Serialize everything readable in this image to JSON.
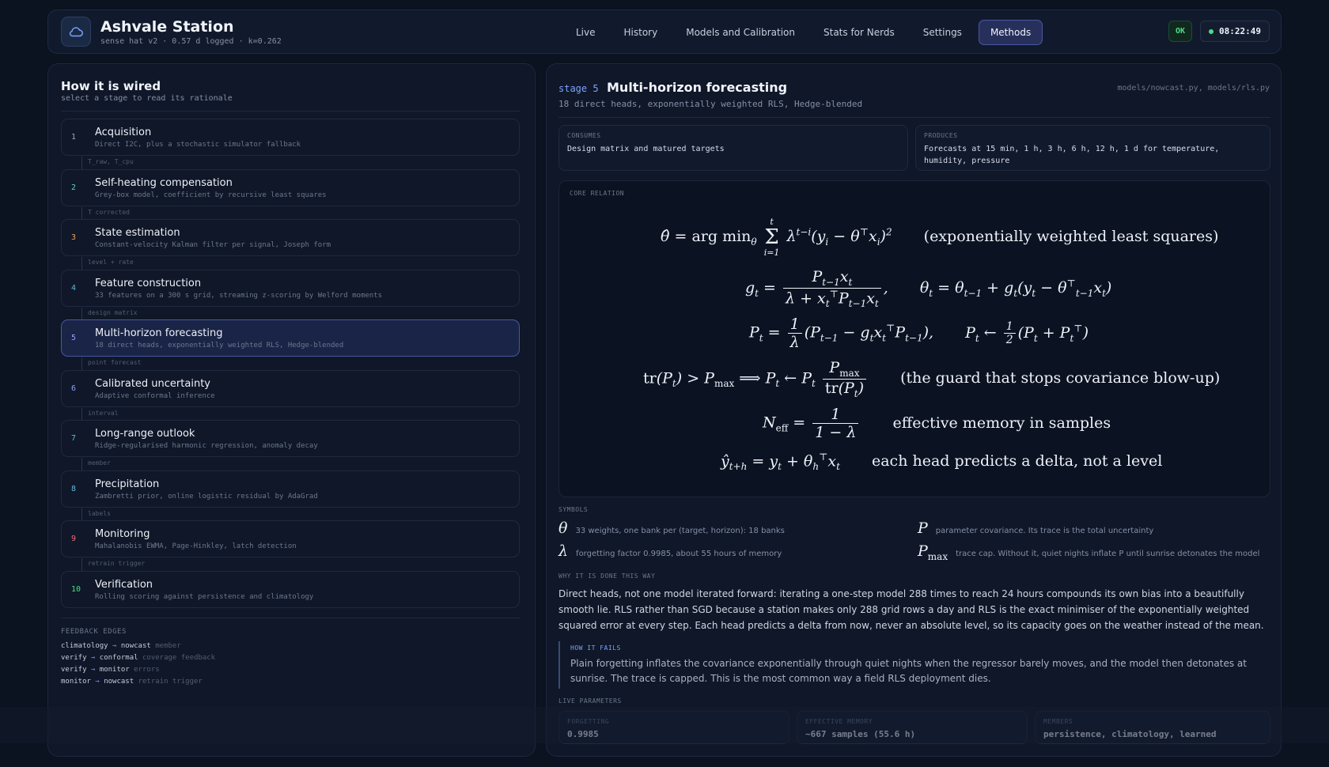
{
  "header": {
    "title": "Ashvale Station",
    "subtitle": "sense hat v2 · 0.57 d logged · k=0.262",
    "nav": [
      "Live",
      "History",
      "Models and Calibration",
      "Stats for Nerds",
      "Settings",
      "Methods"
    ],
    "active_nav": "Methods",
    "status": "OK",
    "clock": "08:22:49"
  },
  "left": {
    "title": "How it is wired",
    "subtitle": "select a stage to read its rationale",
    "stages": [
      {
        "num": "1",
        "name": "Acquisition",
        "desc": "Direct I2C, plus a stochastic simulator fallback",
        "color": "#9aa6bf"
      },
      {
        "num": "2",
        "name": "Self-heating compensation",
        "desc": "Grey-box model, coefficient by recursive least squares",
        "color": "#5fd0c0"
      },
      {
        "num": "3",
        "name": "State estimation",
        "desc": "Constant-velocity Kalman filter per signal, Joseph form",
        "color": "#f0a35a"
      },
      {
        "num": "4",
        "name": "Feature construction",
        "desc": "33 features on a 300 s grid, streaming z-scoring by Welford moments",
        "color": "#5fb8e0"
      },
      {
        "num": "5",
        "name": "Multi-horizon forecasting",
        "desc": "18 direct heads, exponentially weighted RLS, Hedge-blended",
        "color": "#8da2ff"
      },
      {
        "num": "6",
        "name": "Calibrated uncertainty",
        "desc": "Adaptive conformal inference",
        "color": "#8da2ff"
      },
      {
        "num": "7",
        "name": "Long-range outlook",
        "desc": "Ridge-regularised harmonic regression, anomaly decay",
        "color": "#5fb8e0"
      },
      {
        "num": "8",
        "name": "Precipitation",
        "desc": "Zambretti prior, online logistic residual by AdaGrad",
        "color": "#5fb8e0"
      },
      {
        "num": "9",
        "name": "Monitoring",
        "desc": "Mahalanobis EWMA, Page-Hinkley, latch detection",
        "color": "#f06b7a"
      },
      {
        "num": "10",
        "name": "Verification",
        "desc": "Rolling scoring against persistence and climatology",
        "color": "#4ade80"
      }
    ],
    "edges": [
      "T_raw, T_cpu",
      "T corrected",
      "level + rate",
      "design matrix",
      "point forecast",
      "interval",
      "member",
      "labels",
      "retrain trigger"
    ],
    "feedback": {
      "title": "FEEDBACK EDGES",
      "rows": [
        {
          "from": "climatology",
          "to": "nowcast",
          "note": "member"
        },
        {
          "from": "verify",
          "to": "conformal",
          "note": "coverage feedback"
        },
        {
          "from": "verify",
          "to": "monitor",
          "note": "errors"
        },
        {
          "from": "monitor",
          "to": "nowcast",
          "note": "retrain trigger"
        }
      ]
    }
  },
  "detail": {
    "stage_label": "stage 5",
    "title": "Multi-horizon forecasting",
    "subtitle": "18 direct heads, exponentially weighted RLS, Hedge-blended",
    "files": "models/nowcast.py, models/rls.py",
    "consumes_label": "CONSUMES",
    "consumes": "Design matrix and matured targets",
    "produces_label": "PRODUCES",
    "produces": "Forecasts at 15 min, 1 h, 3 h, 6 h, 12 h, 1 d for temperature, humidity, pressure",
    "core_label": "CORE RELATION",
    "eq_notes": {
      "e1": "(exponentially weighted least squares)",
      "e4": "(the guard that stops covariance blow-up)",
      "e5": "effective memory in samples",
      "e6": "each head predicts a delta, not a level"
    },
    "symbols_label": "SYMBOLS",
    "symbols": [
      {
        "glyph": "θ",
        "text": "33 weights, one bank per (target, horizon): 18 banks"
      },
      {
        "glyph": "P",
        "text": "parameter covariance. Its trace is the total uncertainty"
      },
      {
        "glyph": "λ",
        "text": "forgetting factor 0.9985, about 55 hours of memory"
      },
      {
        "glyph": "P",
        "sub": "max",
        "text": "trace cap. Without it, quiet nights inflate P until sunrise detonates the model"
      }
    ],
    "why_label": "WHY IT IS DONE THIS WAY",
    "why": "Direct heads, not one model iterated forward: iterating a one-step model 288 times to reach 24 hours compounds its own bias into a beautifully smooth lie. RLS rather than SGD because a station makes only 288 grid rows a day and RLS is the exact minimiser of the exponentially weighted squared error at every step. Each head predicts a delta from now, never an absolute level, so its capacity goes on the weather instead of the mean.",
    "fails_label": "HOW IT FAILS",
    "fails": "Plain forgetting inflates the covariance exponentially through quiet nights when the regressor barely moves, and the model then detonates at sunrise. The trace is capped. This is the most common way a field RLS deployment dies.",
    "params_label": "LIVE PARAMETERS",
    "params": [
      {
        "label": "FORGETTING",
        "value": "0.9985"
      },
      {
        "label": "EFFECTIVE MEMORY",
        "value": "~667 samples (55.6 h)"
      },
      {
        "label": "MEMBERS",
        "value": "persistence, climatology, learned"
      }
    ]
  }
}
